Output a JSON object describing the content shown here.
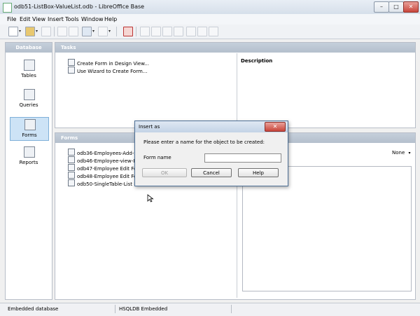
{
  "window": {
    "title": "odb51-ListBox-ValueList.odb - LibreOffice Base",
    "minimize": "–",
    "maximize": "□",
    "close": "✕"
  },
  "menu": [
    "File",
    "Edit",
    "View",
    "Insert",
    "Tools",
    "Window",
    "Help"
  ],
  "sidebar": {
    "title": "Database",
    "items": [
      {
        "label": "Tables",
        "icon": "table-icon"
      },
      {
        "label": "Queries",
        "icon": "query-icon"
      },
      {
        "label": "Forms",
        "icon": "form-icon",
        "selected": true
      },
      {
        "label": "Reports",
        "icon": "report-icon"
      }
    ]
  },
  "tasks": {
    "title": "Tasks",
    "items": [
      "Create Form in Design View...",
      "Use Wizard to Create Form..."
    ],
    "description_title": "Description"
  },
  "forms": {
    "title": "Forms",
    "items": [
      "odb36-Employees-Add-Sul",
      "odb46-Employee-view-Info",
      "odb47-Employee Edit Form",
      "odb48-Employee Edit Form",
      "odb50-SingleTable-List Box"
    ],
    "preview_option": "None"
  },
  "dialog": {
    "title": "Insert as",
    "close": "✕",
    "prompt": "Please enter a name for the object to be created:",
    "field_label": "Form name",
    "field_value": "",
    "buttons": {
      "ok": "OK",
      "cancel": "Cancel",
      "help": "Help"
    }
  },
  "status": {
    "left": "Embedded database",
    "middle": "HSQLDB Embedded"
  }
}
